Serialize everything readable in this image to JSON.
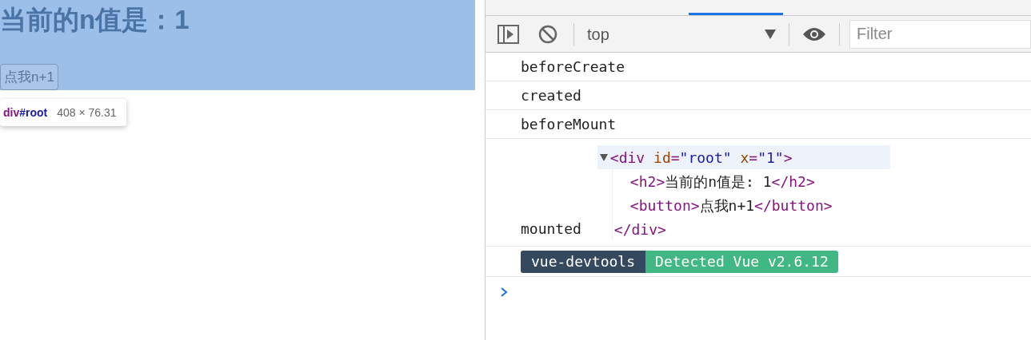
{
  "page": {
    "heading": "当前的n值是：1",
    "button": "点我n+1",
    "tooltip": {
      "selector_tag": "div",
      "selector_id": "#root",
      "size": "408 × 76.31"
    }
  },
  "devtools": {
    "context": "top",
    "filter": {
      "placeholder": "Filter"
    },
    "messages": [
      {
        "kind": "log",
        "text": "beforeCreate"
      },
      {
        "kind": "log",
        "text": "created"
      },
      {
        "kind": "log",
        "text": "beforeMount"
      },
      {
        "kind": "element",
        "text": "mounted",
        "expanded": true,
        "open_line": "<div id=\"root\" x=\"1\">",
        "child_lines": [
          "<h2>当前的n值是: 1</h2>",
          "<button>点我n+1</button>"
        ],
        "close_line": "</div>"
      },
      {
        "kind": "badge",
        "left": "vue-devtools",
        "right": "Detected Vue v2.6.12"
      }
    ]
  }
}
